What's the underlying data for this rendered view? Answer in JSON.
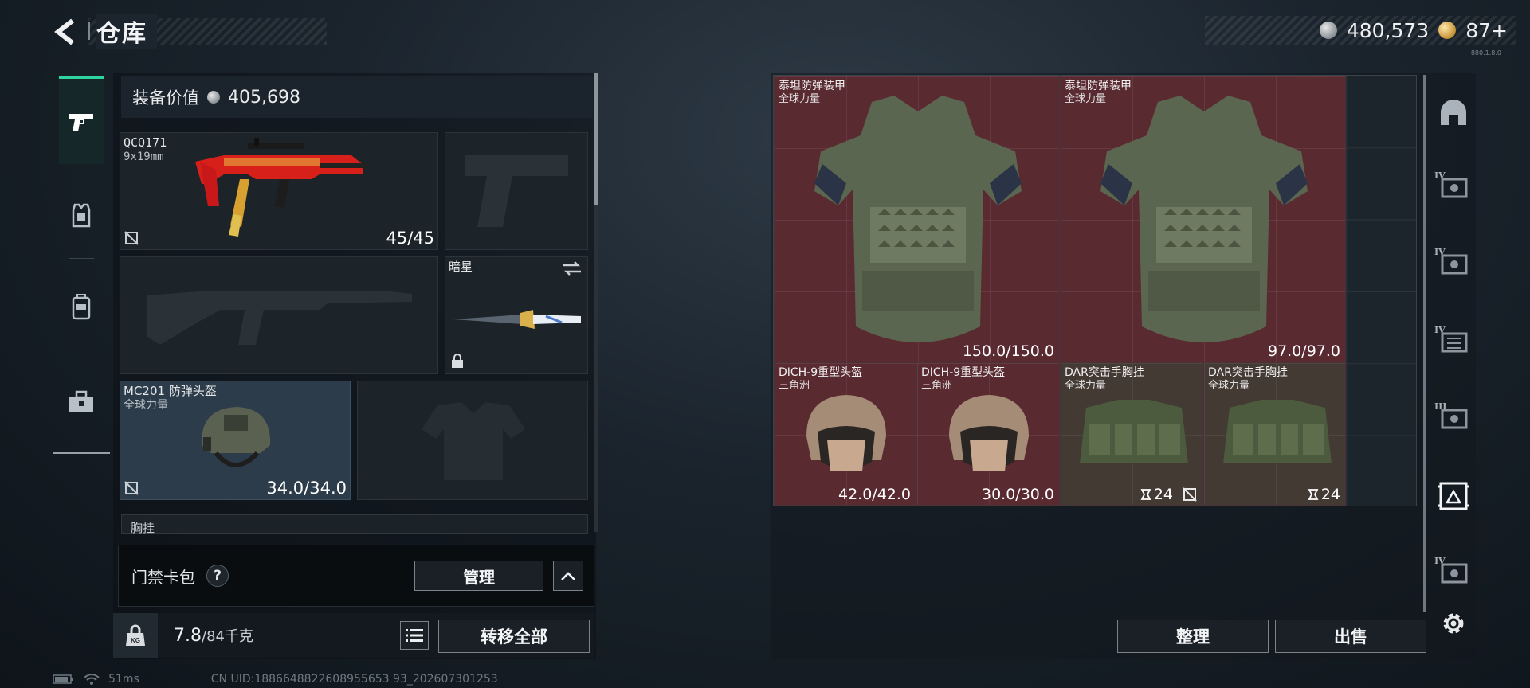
{
  "header": {
    "title": "仓库",
    "currency": [
      {
        "icon": "silver-coin-icon",
        "value": "480,573"
      },
      {
        "icon": "gold-token-icon",
        "value": "87+"
      }
    ],
    "version": "880.1.8.0"
  },
  "left_tabs": [
    {
      "icon": "pistol-icon",
      "active": true
    },
    {
      "icon": "armor-vest-icon",
      "active": false
    },
    {
      "icon": "backpack-icon",
      "active": false
    },
    {
      "icon": "toolbox-icon",
      "active": false
    }
  ],
  "loadout": {
    "value_label": "装备价值",
    "value": "405,698",
    "primary": {
      "name": "QCQ171",
      "caliber": "9x19mm",
      "ammo": "45/45"
    },
    "melee": {
      "name": "暗星"
    },
    "helmet": {
      "name": "MC201 防弹头盔",
      "source": "全球力量",
      "durability": "34.0/34.0"
    },
    "chest_rig_label": "胸挂",
    "keycard_label": "门禁卡包",
    "help": "?",
    "manage": "管理",
    "weight": "7.8",
    "weight_max": "/84千克",
    "kg_badge": "KG",
    "transfer_all": "转移全部"
  },
  "storage": {
    "items": [
      {
        "name": "泰坦防弹装甲",
        "source": "全球力量",
        "durability": "150.0/150.0"
      },
      {
        "name": "泰坦防弹装甲",
        "source": "全球力量",
        "durability": "97.0/97.0"
      },
      {
        "name": "DICH-9重型头盔",
        "source": "三角洲",
        "durability": "42.0/42.0"
      },
      {
        "name": "DICH-9重型头盔",
        "source": "三角洲",
        "durability": "30.0/30.0"
      },
      {
        "name": "DAR突击手胸挂",
        "source": "全球力量",
        "count": "24"
      },
      {
        "name": "DAR突击手胸挂",
        "source": "全球力量",
        "count": "24"
      }
    ],
    "sort": "整理",
    "sell": "出售"
  },
  "right_rail": [
    {
      "icon": "helmet-filter-icon",
      "tier": ""
    },
    {
      "icon": "storage-case-icon",
      "tier": "IV"
    },
    {
      "icon": "storage-case-icon",
      "tier": "IV"
    },
    {
      "icon": "storage-case-icon",
      "tier": "IV"
    },
    {
      "icon": "storage-case-icon",
      "tier": "III"
    },
    {
      "icon": "storage-case-icon",
      "tier": ""
    },
    {
      "icon": "storage-case-icon",
      "tier": "IV"
    }
  ],
  "status": {
    "ping": "51ms",
    "uid": "CN UID:1886648822608955653 93_202607301253"
  }
}
